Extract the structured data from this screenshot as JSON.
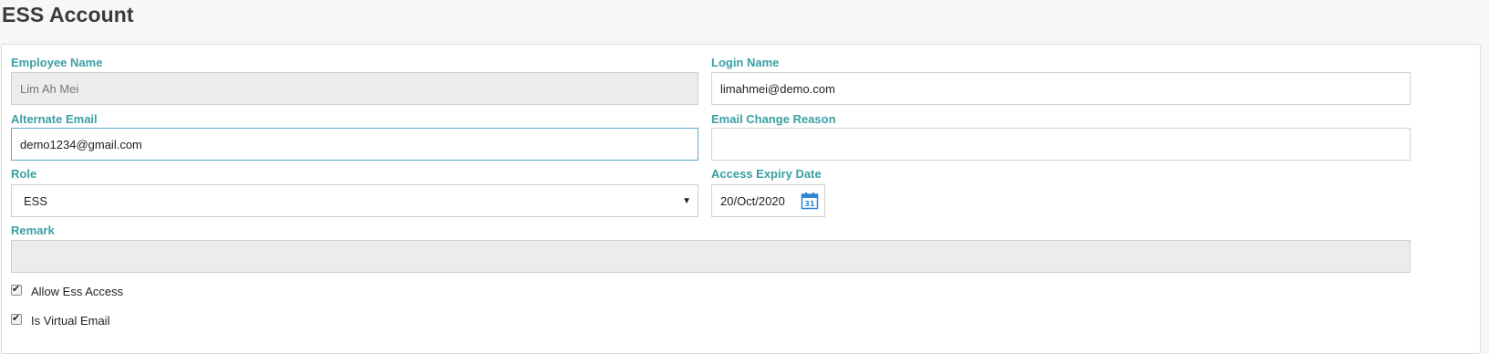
{
  "page": {
    "title": "ESS Account"
  },
  "form": {
    "employee_name": {
      "label": "Employee Name",
      "value": "Lim Ah Mei"
    },
    "login_name": {
      "label": "Login Name",
      "value": "limahmei@demo.com"
    },
    "alternate_email": {
      "label": "Alternate Email",
      "value": "demo1234@gmail.com"
    },
    "email_change_reason": {
      "label": "Email Change Reason",
      "value": ""
    },
    "role": {
      "label": "Role",
      "value": "ESS"
    },
    "access_expiry_date": {
      "label": "Access Expiry Date",
      "value": "20/Oct/2020",
      "icon": "calendar-icon"
    },
    "remark": {
      "label": "Remark",
      "value": ""
    },
    "allow_ess_access": {
      "label": "Allow Ess Access",
      "checked": true
    },
    "is_virtual_email": {
      "label": "Is Virtual Email",
      "checked": true
    }
  },
  "colors": {
    "label": "#3a9fa3",
    "disabled_bg": "#ececec",
    "focus_border": "#5aa9d6"
  }
}
